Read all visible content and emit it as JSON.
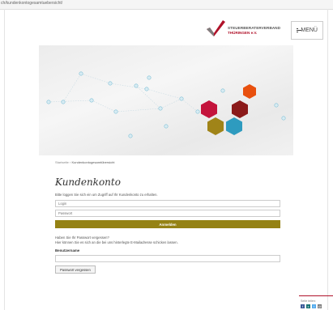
{
  "browser": {
    "url": "ch/kundenkontogesamtuebersicht/"
  },
  "header": {
    "logo_line1": "STEUERBERATERVERBAND",
    "logo_line2": "THÜRINGEN e.V.",
    "menu_label": "MENÜ",
    "brand_color": "#b0122a"
  },
  "breadcrumb": {
    "start": "Startseite",
    "separator": "›",
    "current": "Kundenkontogesamtübersicht"
  },
  "main": {
    "title": "Kundenkonto",
    "intro": "Bitte loggen Sie sich ein um Zugriff auf Ihr Kundenkonto zu erhalten.",
    "login_placeholder": "Login",
    "password_placeholder": "Passwort",
    "submit_label": "Anmelden",
    "forgot_question": "Haben Sie Ihr Passwort vergessen?",
    "forgot_hint": "Hier können Sie es sich an die bei uns hinterlegte E-Mailadresse schicken lassen.",
    "username_label": "Benutzername",
    "username_value": "",
    "reset_label": "Passwort vergessen",
    "button_color": "#958214"
  },
  "share": {
    "label": "Seite teilen:",
    "icons": [
      "facebook-icon",
      "xing-icon",
      "twitter-icon",
      "mail-icon"
    ]
  },
  "hero": {
    "hex_colors": [
      "#e8500e",
      "#c4143c",
      "#8b1a1a",
      "#a08418",
      "#2e9bbf"
    ]
  }
}
